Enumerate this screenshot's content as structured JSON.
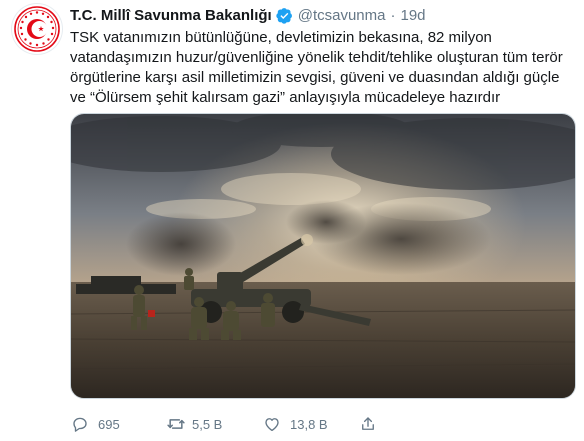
{
  "tweet": {
    "author_name": "T.C. Millî Savunma Bakanlığı",
    "handle": "@tcsavunma",
    "separator": "·",
    "time": "19d",
    "text": "TSK vatanımızın bütünlüğüne, devletimizin bekasına, 82 milyon vatandaşımızın huzur/güvenliğine yönelik tehdit/tehlike oluşturan tüm terör örgütlerine karşı asil milletimizin sevgisi, güveni ve duasından aldığı güçle ve “Ölürsem şehit kalırsam gazi” anlayışıyla mücadeleye hazırdır",
    "media": {
      "icon": "photo-howitzer-soldiers"
    },
    "actions": {
      "replies": "695",
      "retweets": "5,5 B",
      "likes": "13,8 B"
    }
  },
  "colors": {
    "text": "#14171a",
    "secondary": "#657786",
    "verified": "#1da1f2",
    "emblem_red": "#e30a17"
  }
}
